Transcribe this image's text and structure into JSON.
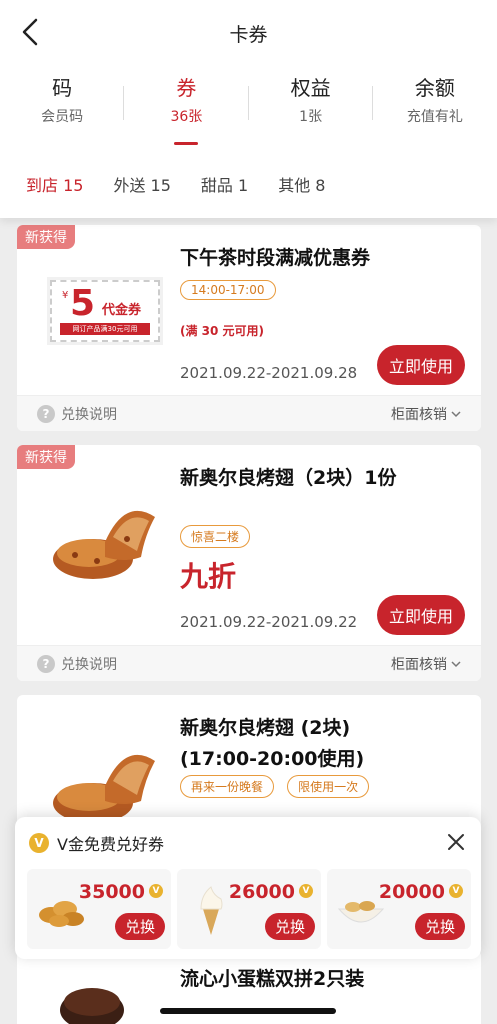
{
  "nav": {
    "title": "卡券"
  },
  "categories": [
    {
      "title": "码",
      "sub": "会员码"
    },
    {
      "title": "券",
      "sub": "36张"
    },
    {
      "title": "权益",
      "sub": "1张"
    },
    {
      "title": "余额",
      "sub": "充值有礼"
    }
  ],
  "subtabs": [
    "到店 15",
    "外送 15",
    "甜品 1",
    "其他 8"
  ],
  "cards": [
    {
      "badge": "新获得",
      "title": "下午茶时段满减优惠券",
      "tags": [
        "14:00-17:00"
      ],
      "condition": "(满 30 元可用)",
      "date": "2021.09.22-2021.09.28",
      "button": "立即使用",
      "help": "兑换说明",
      "verify": "柜面核销",
      "ticket": {
        "yen": "¥",
        "num": "5",
        "label": "代金券",
        "strip": "网订产品满30元可用"
      }
    },
    {
      "badge": "新获得",
      "title": "新奥尔良烤翅（2块）1份",
      "tags": [
        "惊喜二楼"
      ],
      "discount": "九折",
      "date": "2021.09.22-2021.09.22",
      "button": "立即使用",
      "help": "兑换说明",
      "verify": "柜面核销"
    },
    {
      "title": "新奥尔良烤翅 (2块) (17:00-20:00使用)",
      "tags": [
        "再来一份晚餐",
        "限使用一次"
      ]
    }
  ],
  "popup": {
    "title": "V金免费兑好券",
    "coin": "V",
    "items": [
      {
        "price": "35000",
        "button": "兑换"
      },
      {
        "price": "26000",
        "button": "兑换"
      },
      {
        "price": "20000",
        "button": "兑换"
      }
    ]
  },
  "bottom": {
    "title": "流心小蛋糕双拼2只装"
  }
}
